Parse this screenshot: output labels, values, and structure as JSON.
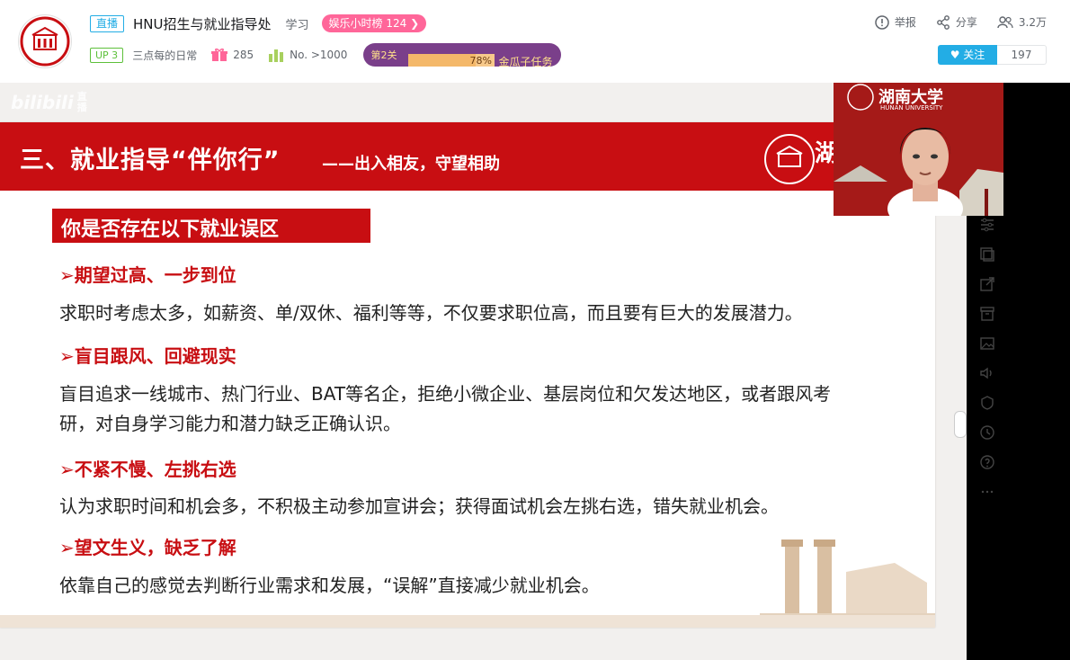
{
  "header": {
    "live_tag": "直播",
    "room_title": "HNU招生与就业指导处",
    "area": "学习",
    "rank_label": "娱乐小时榜 124",
    "up_tag": "UP 3",
    "anchor": "三点每的日常",
    "gift_count": "285",
    "popularity_rank": "No. >1000",
    "task": {
      "level": "第2关",
      "progress_text": "78%",
      "progress_value": 0.78,
      "label": "金瓜子任务"
    },
    "actions": {
      "report": "举报",
      "share": "分享",
      "viewers": "3.2万"
    },
    "follow_label": "关注",
    "follow_count": "197"
  },
  "player": {
    "watermark": "bilibili",
    "watermark_small": "直播",
    "camera_school_name": "湖南大学",
    "camera_school_en": "HUNAN UNIVERSITY"
  },
  "slide": {
    "title": "三、就业指导“伴你行”",
    "subtitle": "——出入相友，守望相助",
    "logo_text": "湖南",
    "question": "你是否存在以下就业误区",
    "points": [
      {
        "title": "➢期望过高、一步到位",
        "body": "求职时考虑太多，如薪资、单/双休、福利等等，不仅要求职位高，而且要有巨大的发展潜力。"
      },
      {
        "title": "➢盲目跟风、回避现实",
        "body": "盲目追求一线城市、热门行业、BAT等名企，拒绝小微企业、基层岗位和欠发达地区，或者跟风考研，对自身学习能力和潜力缺乏正确认识。"
      },
      {
        "title": "➢不紧不慢、左挑右选",
        "body": "认为求职时间和机会多，不积极主动参加宣讲会；获得面试机会左挑右选，错失就业机会。"
      },
      {
        "title": "➢望文生义，缺乏了解",
        "body": "依靠自己的感觉去判断行业需求和发展，“误解”直接减少就业机会。"
      }
    ]
  },
  "colors": {
    "brand_red": "#c80e12",
    "accent_blue": "#23ade5",
    "pink": "#ff6699",
    "purple": "#7a3f8a"
  }
}
